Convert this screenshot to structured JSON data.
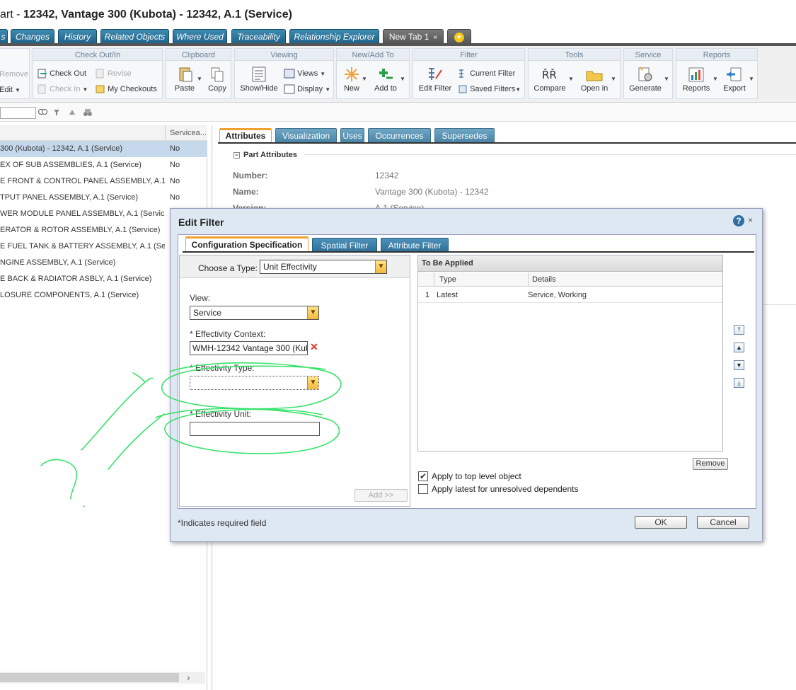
{
  "window": {
    "title_prefix": "art - ",
    "title_main": "12342, Vantage 300 (Kubota) - 12342, A.1 (Service)"
  },
  "top_tabs": [
    {
      "label": "s"
    },
    {
      "label": "Changes"
    },
    {
      "label": "History"
    },
    {
      "label": "Related Objects"
    },
    {
      "label": "Where Used"
    },
    {
      "label": "Traceability"
    },
    {
      "label": "Relationship Explorer"
    },
    {
      "label": "New Tab 1",
      "close": "×"
    }
  ],
  "toolbar": {
    "edit_group": {
      "remove": "Remove",
      "edit": "Edit"
    },
    "checkout": {
      "title": "Check Out/In",
      "check_out": "Check Out",
      "revise": "Revise",
      "check_in": "Check In",
      "my_checkouts": "My Checkouts"
    },
    "clipboard": {
      "title": "Clipboard",
      "paste": "Paste",
      "copy": "Copy"
    },
    "viewing": {
      "title": "Viewing",
      "show_hide": "Show/Hide",
      "views": "Views",
      "display": "Display"
    },
    "new_add": {
      "title": "New/Add To",
      "new": "New",
      "add_to": "Add to"
    },
    "filter": {
      "title": "Filter",
      "edit_filter": "Edit Filter",
      "current_filter": "Current Filter",
      "saved_filters": "Saved Filters"
    },
    "tools": {
      "title": "Tools",
      "compare": "Compare",
      "open_in": "Open in"
    },
    "service": {
      "title": "Service",
      "generate": "Generate"
    },
    "reports": {
      "title": "Reports",
      "reports": "Reports",
      "export": "Export"
    }
  },
  "tree": {
    "col_header": "Serviceа...",
    "rows": [
      {
        "name": "300 (Kubota) - 12342, A.1 (Service)",
        "serviceable": "No",
        "selected": true
      },
      {
        "name": "EX OF SUB ASSEMBLIES, A.1 (Service)",
        "serviceable": "No"
      },
      {
        "name": "E FRONT & CONTROL PANEL ASSEMBLY, A.1 (Se",
        "serviceable": "No"
      },
      {
        "name": "TPUT PANEL ASSEMBLY, A.1 (Service)",
        "serviceable": "No"
      },
      {
        "name": "WER MODULE PANEL ASSEMBLY, A.1 (Service)",
        "serviceable": ""
      },
      {
        "name": "ERATOR & ROTOR ASSEMBLY, A.1 (Service)",
        "serviceable": ""
      },
      {
        "name": "E FUEL TANK & BATTERY ASSEMBLY, A.1 (Servic",
        "serviceable": ""
      },
      {
        "name": "NGINE ASSEMBLY, A.1 (Service)",
        "serviceable": ""
      },
      {
        "name": "E BACK & RADIATOR ASBLY, A.1 (Service)",
        "serviceable": ""
      },
      {
        "name": "LOSURE COMPONENTS, A.1 (Service)",
        "serviceable": ""
      }
    ]
  },
  "details": {
    "tabs": [
      "Attributes",
      "Visualization",
      "Uses",
      "Occurrences",
      "Supersedes"
    ],
    "section_title": "Part Attributes",
    "attributes": [
      {
        "label": "Number:",
        "value": "12342"
      },
      {
        "label": "Name:",
        "value": "Vantage 300 (Kubota) - 12342"
      },
      {
        "label": "Version:",
        "value": "A.1 (Service)"
      }
    ]
  },
  "dialog": {
    "title": "Edit Filter",
    "help": "?",
    "close": "×",
    "tabs": [
      "Configuration Specification",
      "Spatial Filter",
      "Attribute Filter"
    ],
    "choose_type_label": "Choose a Type:",
    "choose_type_value": "Unit Effectivity",
    "view_label": "View:",
    "view_value": "Service",
    "eff_context_label": "* Effectivity Context:",
    "eff_context_value": "WMH-12342 Vantage 300 (Kub",
    "eff_type_label": "* Effectivity Type:",
    "eff_type_value": "",
    "eff_unit_label": "* Effectivity Unit:",
    "eff_unit_value": "",
    "add_button": "Add >>",
    "to_be_applied": {
      "title": "To Be Applied",
      "columns": [
        "Type",
        "Details"
      ],
      "rows": [
        {
          "index": "1",
          "type": "Latest",
          "details": "Service, Working"
        }
      ]
    },
    "remove_button": "Remove",
    "apply_top_level": "Apply to top level object",
    "apply_top_level_checked": true,
    "apply_latest": "Apply latest for unresolved dependents",
    "apply_latest_checked": false,
    "required_note": "*Indicates required field",
    "ok": "OK",
    "cancel": "Cancel"
  },
  "colors": {
    "tab_blue": "#2b6d96",
    "annotation_green": "#37e26a",
    "selection": "#c6d9ec"
  }
}
